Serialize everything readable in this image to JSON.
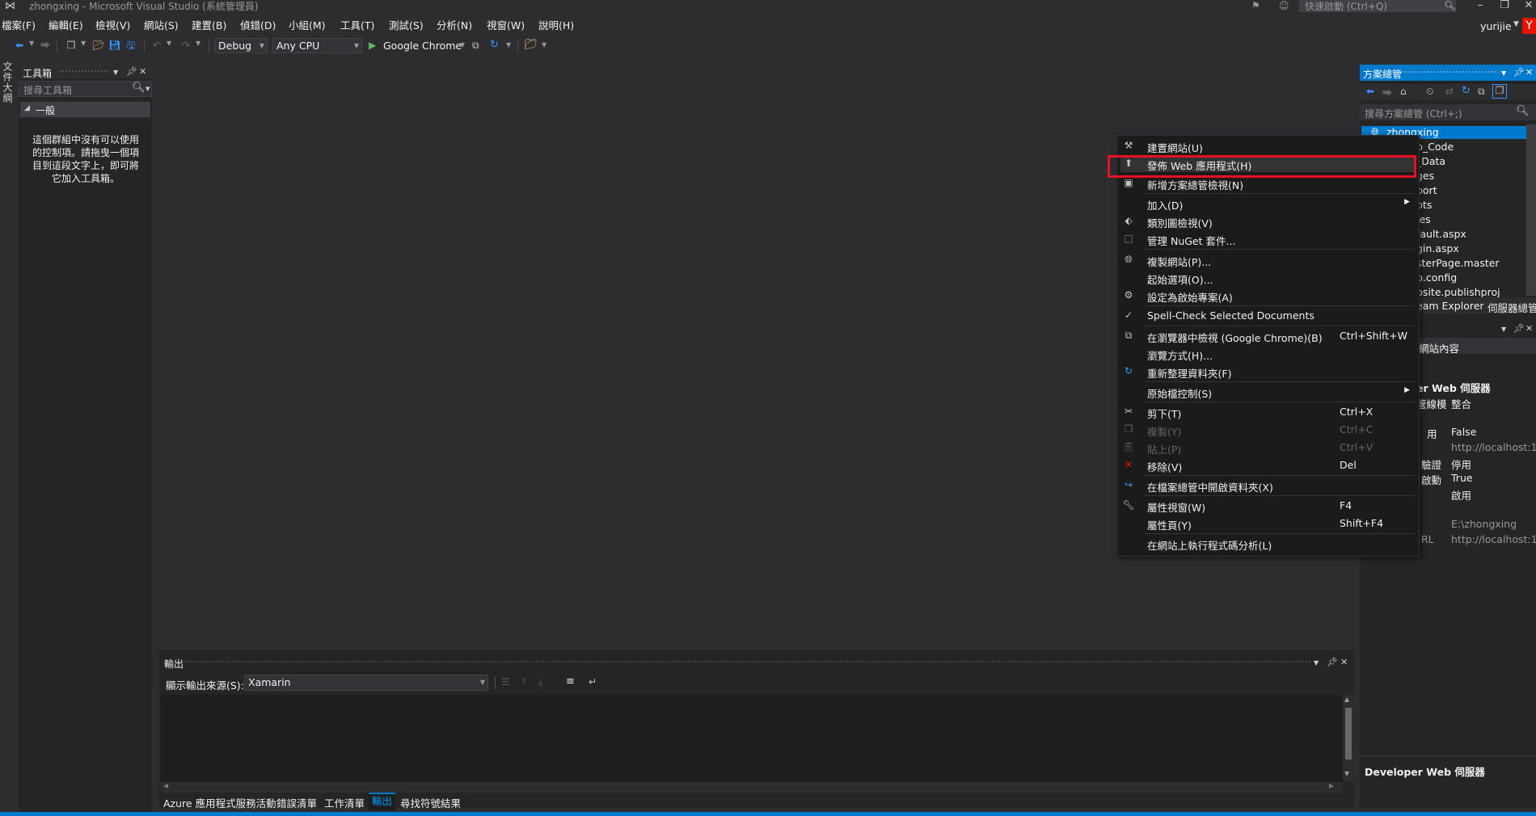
{
  "window": {
    "title": "zhongxing - Microsoft Visual Studio (系統管理員)",
    "quick_launch_placeholder": "快速啟動 (Ctrl+Q)",
    "user": "yurijie",
    "user_badge": "Y"
  },
  "menu": [
    "檔案(F)",
    "編輯(E)",
    "檢視(V)",
    "網站(S)",
    "建置(B)",
    "偵錯(D)",
    "小組(M)",
    "工具(T)",
    "測試(S)",
    "分析(N)",
    "視窗(W)",
    "說明(H)"
  ],
  "toolbar": {
    "configuration": "Debug",
    "platform": "Any CPU",
    "run_target": "Google Chrome"
  },
  "doc_outline_tab": "文件大綱",
  "toolbox": {
    "title": "工具箱",
    "search_placeholder": "搜尋工具箱",
    "group": "一般",
    "empty_message": "這個群組中沒有可以使用的控制項。請拖曳一個項目到這段文字上，即可將它加入工具箱。"
  },
  "output": {
    "title": "輸出",
    "source_label": "顯示輸出來源(S):",
    "source_value": "Xamarin"
  },
  "bottom_tabs": [
    "Azure 應用程式服務活動",
    "錯誤清單",
    "工作清單",
    "輸出",
    "尋找符號結果"
  ],
  "solution_explorer": {
    "title": "方案總管",
    "search_placeholder": "搜尋方案總管 (Ctrl+;)",
    "items": [
      "zhongxing",
      "p_Code",
      "_Data",
      "ges",
      "port",
      "pts",
      "les",
      "fault.aspx",
      "gin.aspx",
      "sterPage.master",
      "b.config",
      "bsite.publishproj"
    ],
    "tabs": [
      "eam Explorer",
      "伺服器總管"
    ]
  },
  "properties": {
    "dropdown": "網站內容",
    "category": "er Web 伺服器",
    "rows": [
      {
        "name": "管線模",
        "value": "整合"
      },
      {
        "name": "用",
        "value": "False"
      },
      {
        "name": "",
        "value": "http://localhost:12"
      },
      {
        "name": "驗證",
        "value": "停用"
      },
      {
        "name": "啟動",
        "value": "True"
      },
      {
        "name": "",
        "value": "啟用"
      },
      {
        "name": "",
        "value": "E:\\zhongxing"
      },
      {
        "name": "RL",
        "value": "http://localhost:12"
      }
    ],
    "description": "Developer Web 伺服器"
  },
  "context_menu": [
    {
      "label": "建置網站(U)",
      "shortcut": "",
      "icon": "build-icon"
    },
    {
      "label": "發佈 Web 應用程式(H)",
      "shortcut": "",
      "icon": "publish-icon"
    },
    {
      "label": "新增方案總管檢視(N)",
      "shortcut": "",
      "icon": "new-view-icon"
    },
    {
      "label": "加入(D)",
      "shortcut": "",
      "icon": ""
    },
    {
      "label": "類別圖檢視(V)",
      "shortcut": "",
      "icon": "class-diagram-icon"
    },
    {
      "label": "管理 NuGet 套件...",
      "shortcut": "",
      "icon": "nuget-icon"
    },
    {
      "label": "複製網站(P)...",
      "shortcut": "",
      "icon": "copy-website-icon"
    },
    {
      "label": "起始選項(O)...",
      "shortcut": "",
      "icon": ""
    },
    {
      "label": "設定為啟始專案(A)",
      "shortcut": "",
      "icon": "gear-icon"
    },
    {
      "label": "Spell-Check Selected Documents",
      "shortcut": "",
      "icon": "spell-check-icon"
    },
    {
      "label": "在瀏覽器中檢視 (Google Chrome)(B)",
      "shortcut": "Ctrl+Shift+W",
      "icon": "browser-icon"
    },
    {
      "label": "瀏覽方式(H)...",
      "shortcut": "",
      "icon": ""
    },
    {
      "label": "重新整理資料夾(F)",
      "shortcut": "",
      "icon": "refresh-icon"
    },
    {
      "label": "原始檔控制(S)",
      "shortcut": "",
      "icon": ""
    },
    {
      "label": "剪下(T)",
      "shortcut": "Ctrl+X",
      "icon": "cut-icon"
    },
    {
      "label": "複製(Y)",
      "shortcut": "Ctrl+C",
      "icon": "copy-icon"
    },
    {
      "label": "貼上(P)",
      "shortcut": "Ctrl+V",
      "icon": "paste-icon"
    },
    {
      "label": "移除(V)",
      "shortcut": "Del",
      "icon": "remove-icon"
    },
    {
      "label": "在檔案總管中開啟資料夾(X)",
      "shortcut": "",
      "icon": "open-folder-icon"
    },
    {
      "label": "屬性視窗(W)",
      "shortcut": "F4",
      "icon": "wrench-icon"
    },
    {
      "label": "屬性頁(Y)",
      "shortcut": "Shift+F4",
      "icon": ""
    },
    {
      "label": "在網站上執行程式碼分析(L)",
      "shortcut": "",
      "icon": ""
    }
  ]
}
